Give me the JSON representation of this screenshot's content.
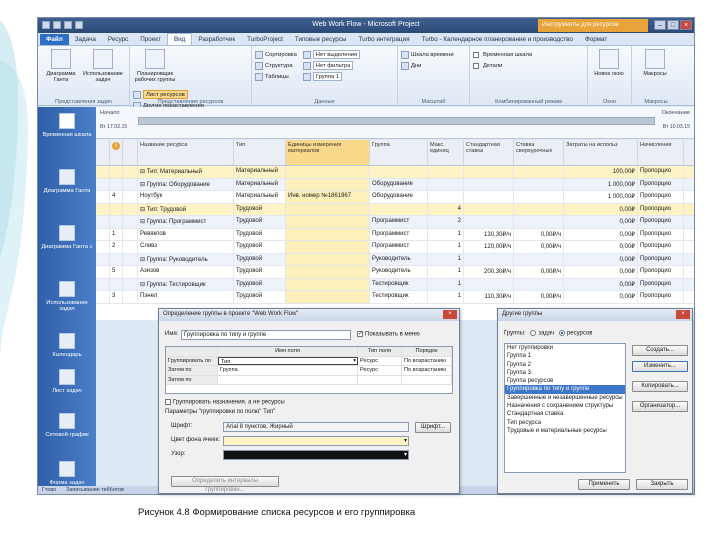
{
  "window": {
    "title": "Web Work Flow - Microsoft Project",
    "context_tab": "Инструменты для ресурсов"
  },
  "tabs": [
    "Файл",
    "Задача",
    "Ресурс",
    "Проект",
    "Вид",
    "Разработчик",
    "TurboProject",
    "Типовые ресурсы",
    "Turbo интеграция",
    "Turbo - Календарное планирование и производство",
    "Формат"
  ],
  "ribbon": {
    "groups": [
      {
        "label": "Представления задач",
        "buttons": [
          "Диаграмма Ганта",
          "Использование задач"
        ]
      },
      {
        "label": "Представления ресурсов",
        "buttons": [
          "Планировщик рабочих группы"
        ],
        "rows": [
          "Лист ресурсов",
          "Другие представления"
        ]
      },
      {
        "label": "Данные",
        "rows": [
          "Сортировка",
          "Структура",
          "Таблицы",
          "Нет выделения",
          "Нет фильтра",
          "Группа 1"
        ]
      },
      {
        "label": "Масштаб",
        "rows": [
          "Шкала времени",
          "Дни"
        ]
      },
      {
        "label": "Комбинированный режим",
        "rows": [
          "Временная шкала",
          "Детали"
        ]
      },
      {
        "label": "Окно",
        "buttons": [
          "Новое окно"
        ]
      },
      {
        "label": "Макросы",
        "buttons": [
          "Макросы"
        ]
      }
    ]
  },
  "sidebar": [
    "Временная шкала",
    "Диаграмма Ганта",
    "Диаграмма Ганта с",
    "Использование задач",
    "Календарь",
    "Лист задач",
    "Сетевой график",
    "Форма задач"
  ],
  "timeline": {
    "start_label": "Начало",
    "start_date": "Вт 17.02.15",
    "end_label": "Окончание",
    "end_date": "Вт 10.03.15"
  },
  "grid": {
    "headers": [
      "",
      "",
      "Название ресурса",
      "Тип",
      "Единицы измерения материалов",
      "Группа",
      "Макс. единиц",
      "Стандартная ставка",
      "Ставка сверхурочных",
      "Затраты на использ",
      "Начисление"
    ],
    "rows": [
      {
        "kind": "grp",
        "id": "",
        "name": "⊟ Тип: Материальный",
        "type": "Материальный",
        "units": "",
        "group": "",
        "max": "",
        "std": "",
        "ovt": "",
        "cost": "100,00₽",
        "accr": "Пропорцио"
      },
      {
        "kind": "grp2",
        "id": "",
        "name": "⊟ Группа: Оборудование",
        "type": "Материальный",
        "units": "",
        "group": "Оборудование",
        "max": "",
        "std": "",
        "ovt": "",
        "cost": "1 000,00₽",
        "accr": "Пропорцио"
      },
      {
        "kind": "row",
        "id": "4",
        "name": "Ноутбук",
        "type": "Материальный",
        "units": "Инв. номер №1861967",
        "group": "Оборудование",
        "max": "",
        "std": "",
        "ovt": "",
        "cost": "1 000,00₽",
        "accr": "Пропорцио"
      },
      {
        "kind": "grp",
        "id": "",
        "name": "⊟ Тип: Трудовой",
        "type": "Трудовой",
        "units": "",
        "group": "",
        "max": "4",
        "std": "",
        "ovt": "",
        "cost": "0,00₽",
        "accr": "Пропорцио"
      },
      {
        "kind": "grp2",
        "id": "",
        "name": "⊟ Группа: Программист",
        "type": "Трудовой",
        "units": "",
        "group": "Программист",
        "max": "2",
        "std": "",
        "ovt": "",
        "cost": "0,00₽",
        "accr": "Пропорцио"
      },
      {
        "kind": "row",
        "id": "1",
        "name": "Ревякпов",
        "type": "Трудовой",
        "units": "",
        "group": "Программист",
        "max": "1",
        "std": "130,30₽/ч",
        "ovt": "0,00₽/ч",
        "cost": "0,00₽",
        "accr": "Пропорцио"
      },
      {
        "kind": "row",
        "id": "2",
        "name": "Сливз",
        "type": "Трудовой",
        "units": "",
        "group": "Программист",
        "max": "1",
        "std": "120,00₽/ч",
        "ovt": "0,00₽/ч",
        "cost": "0,00₽",
        "accr": "Пропорцио"
      },
      {
        "kind": "grp2",
        "id": "",
        "name": "⊟ Группа: Руководитель",
        "type": "Трудовой",
        "units": "",
        "group": "Руководитель",
        "max": "1",
        "std": "",
        "ovt": "",
        "cost": "0,00₽",
        "accr": "Пропорцио"
      },
      {
        "kind": "row",
        "id": "5",
        "name": "Азизов",
        "type": "Трудовой",
        "units": "",
        "group": "Руководитель",
        "max": "1",
        "std": "200,30₽/ч",
        "ovt": "0,00₽/ч",
        "cost": "0,00₽",
        "accr": "Пропорцио"
      },
      {
        "kind": "grp2",
        "id": "",
        "name": "⊟ Группа: Тестировщик",
        "type": "Трудовой",
        "units": "",
        "group": "Тестировщик",
        "max": "1",
        "std": "",
        "ovt": "",
        "cost": "0,00₽",
        "accr": "Пропорцио"
      },
      {
        "kind": "row",
        "id": "3",
        "name": "Пэнел",
        "type": "Трудовой",
        "units": "",
        "group": "Тестировщик",
        "max": "1",
        "std": "110,30₽/ч",
        "ovt": "0,00₽/ч",
        "cost": "0,00₽",
        "accr": "Пропорцио"
      }
    ]
  },
  "statusbar": [
    "Гтово",
    "Записывание тебботов"
  ],
  "dialog_define": {
    "title": "Определение группы в проекте \"Web Work Flow\"",
    "name_label": "Имя:",
    "name_value": "Группировка по типу и группе",
    "show_in_menu": "Показывать в меню",
    "col_headers": [
      "",
      "Имя поля",
      "Тип поля",
      "Порядок"
    ],
    "rows": [
      {
        "label": "Группировать по",
        "field": "Тип",
        "ftype": "Ресурс",
        "order": "По возрастанию"
      },
      {
        "label": "Затем по",
        "field": "Группа",
        "ftype": "Ресурс",
        "order": "По возрастанию"
      },
      {
        "label": "Затем по",
        "field": "",
        "ftype": "",
        "order": ""
      }
    ],
    "grp_assign": "Группировать назначения, а не ресурсы",
    "params_label": "Параметры \"группировки по полю\" Тип\"",
    "font_label": "Шрифт:",
    "font_value": "Arial 8 пунктов, Жирный",
    "font_btn": "Шрифт...",
    "cell_label": "Цвет фона ячеек:",
    "pattern_label": "Узор:",
    "define_btn": "Определить интервалы группировки...",
    "show_summary": "Показать итоговые задачи",
    "maintain": "Сохранять иерархию",
    "ok": "ОК",
    "cancel": "Отмена",
    "help": "Справка"
  },
  "dialog_more": {
    "title": "Другие группы",
    "groups_label": "Группы:",
    "opt_tasks": "задач",
    "opt_resources": "ресурсов",
    "items": [
      "Нет группировки",
      "Группа 1",
      "Группа 2",
      "Группа 3",
      "Группа ресурсов",
      "Группировка по типу и группе",
      "Завершенные и незавершенные ресурсы",
      "Назначения с сохранением структуры",
      "Стандартная ставка",
      "Тип ресурса",
      "Трудовые и материальные ресурсы"
    ],
    "selected_index": 5,
    "btn_new": "Создать...",
    "btn_edit": "Изменить...",
    "btn_copy": "Копировать...",
    "btn_organizer": "Организатор...",
    "btn_apply": "Применить",
    "btn_close": "Закрыть"
  },
  "caption": "Рисунок 4.8 Формирование списка ресурсов и его группировка"
}
